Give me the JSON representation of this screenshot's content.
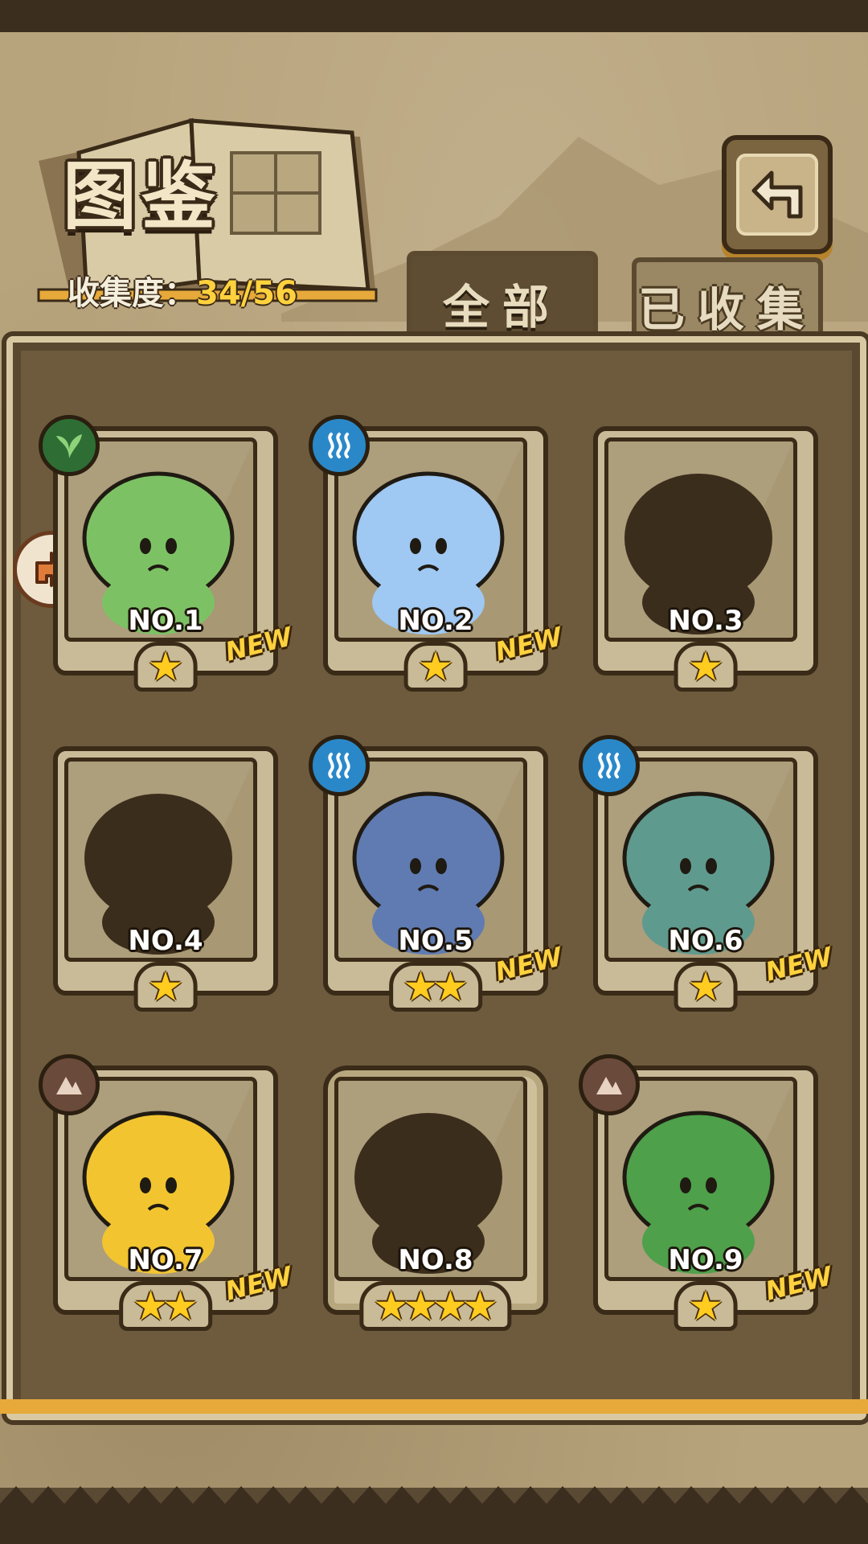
{
  "header": {
    "title": "图鉴",
    "collect_label": "收集度：",
    "collect_value": "34/56"
  },
  "tabs": [
    {
      "label": "全部",
      "active": true
    },
    {
      "label": "已收集",
      "active": false
    }
  ],
  "cards": [
    {
      "num": "NO.1",
      "stars": 1,
      "new": "NEW",
      "element": "leaf-icon",
      "unlocked": true,
      "color": "#7cc265"
    },
    {
      "num": "NO.2",
      "stars": 1,
      "new": "NEW",
      "element": "water-icon",
      "unlocked": true,
      "color": "#9fc8f2"
    },
    {
      "num": "NO.3",
      "stars": 1,
      "new": "",
      "element": "",
      "unlocked": false,
      "color": "#3b2d1c"
    },
    {
      "num": "NO.4",
      "stars": 1,
      "new": "",
      "element": "",
      "unlocked": false,
      "color": "#3b2d1c"
    },
    {
      "num": "NO.5",
      "stars": 2,
      "new": "NEW",
      "element": "water-icon",
      "unlocked": true,
      "color": "#5f7bb2"
    },
    {
      "num": "NO.6",
      "stars": 1,
      "new": "NEW",
      "element": "water-icon",
      "unlocked": true,
      "color": "#5f9a8e"
    },
    {
      "num": "NO.7",
      "stars": 2,
      "new": "NEW",
      "element": "earth-icon",
      "unlocked": true,
      "color": "#f2c430"
    },
    {
      "num": "NO.8",
      "stars": 4,
      "new": "",
      "element": "",
      "unlocked": false,
      "color": "#3b2d1c"
    },
    {
      "num": "NO.9",
      "stars": 1,
      "new": "NEW",
      "element": "earth-icon",
      "unlocked": true,
      "color": "#4ea04a"
    }
  ],
  "colors": {
    "accent_yellow": "#ffd23e",
    "frame_brown": "#6e5b3d",
    "silhouette": "#3b2d1c"
  }
}
